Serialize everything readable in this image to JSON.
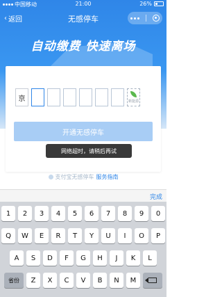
{
  "status": {
    "carrier": "中国移动",
    "time": "21:00",
    "battery": "26%"
  },
  "nav": {
    "back_label": "返回",
    "title": "无感停车"
  },
  "slogan": "自动缴费 快速离场",
  "plate": {
    "first_char": "京",
    "energy_label": "新能源"
  },
  "button": {
    "label": "开通无感停车"
  },
  "toast": "网络超时，请稍后再试",
  "footer": {
    "prefix": "支付宝无感停车",
    "link": "服务指南"
  },
  "keyboard": {
    "done_label": "完成",
    "row1": [
      "1",
      "2",
      "3",
      "4",
      "5",
      "6",
      "7",
      "8",
      "9",
      "0"
    ],
    "row2": [
      "Q",
      "W",
      "E",
      "R",
      "T",
      "Y",
      "U",
      "I",
      "O",
      "P"
    ],
    "row3": [
      "A",
      "S",
      "D",
      "F",
      "G",
      "H",
      "J",
      "K",
      "L"
    ],
    "row4": [
      "Z",
      "X",
      "C",
      "V",
      "B",
      "N",
      "M"
    ],
    "province_label": "省份"
  }
}
